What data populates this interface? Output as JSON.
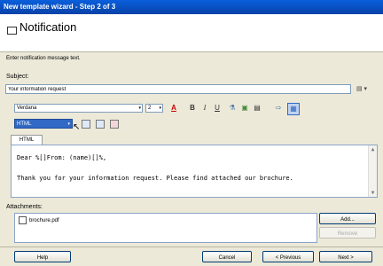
{
  "window": {
    "title": "New template wizard - Step 2 of 3"
  },
  "header": {
    "title": "Notification"
  },
  "instruction": "Enter notification message text.",
  "subject": {
    "label": "Subject:",
    "value": "Your information request",
    "menu": "▤ ▾"
  },
  "toolbar": {
    "font": "Verdana",
    "size": "2",
    "dropdown_arrow": "▾",
    "buttons": {
      "font_color": "A",
      "bold": "B",
      "italic": "I",
      "underline": "U",
      "link": "⚗",
      "image": "▣",
      "list": "▤",
      "more": "⇨",
      "view": "▦"
    }
  },
  "format": {
    "selected": "HTML"
  },
  "tab": {
    "label": "HTML"
  },
  "editor": {
    "line1": "Dear %[]From: (name)[]%,",
    "line2": "Thank you for your information request. Please find attached our brochure."
  },
  "attachments": {
    "label": "Attachments:",
    "items": [
      "brochure.pdf"
    ],
    "add": "Add...",
    "remove": "Remove"
  },
  "footer": {
    "help": "Help",
    "cancel": "Cancel",
    "previous": "< Previous",
    "next": "Next >"
  }
}
